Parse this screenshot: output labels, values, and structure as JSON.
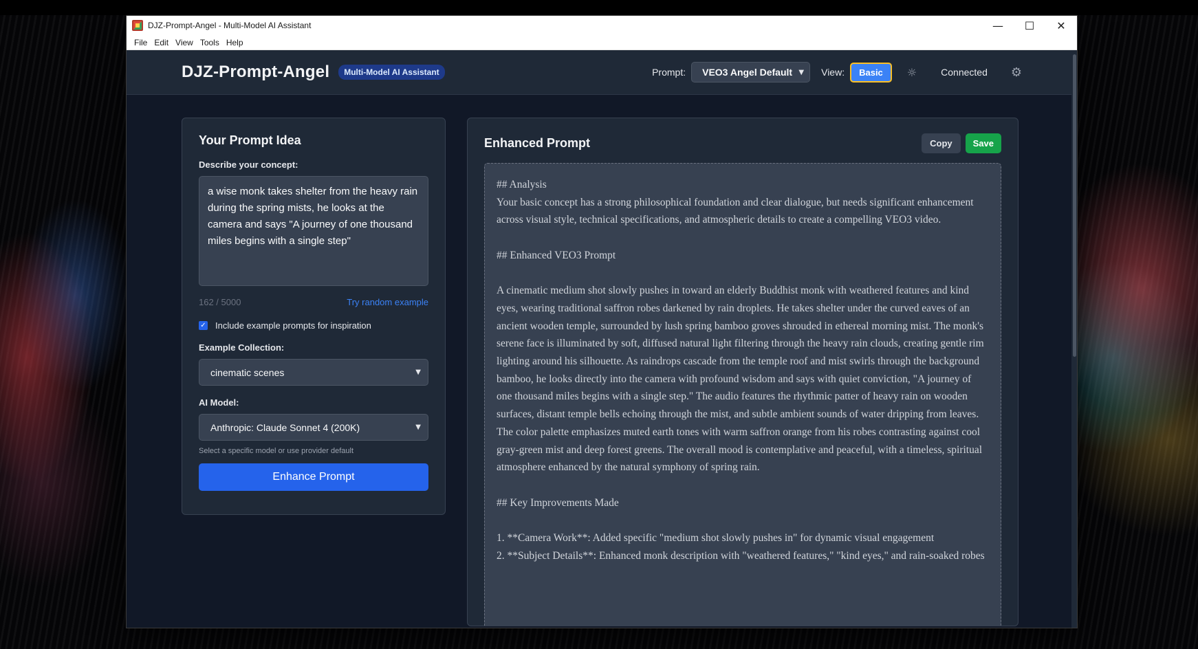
{
  "window": {
    "title": "DJZ-Prompt-Angel - Multi-Model AI Assistant",
    "controls": {
      "minimize": "—",
      "maximize": "☐",
      "close": "✕"
    }
  },
  "menu": [
    "File",
    "Edit",
    "View",
    "Tools",
    "Help"
  ],
  "header": {
    "brand": "DJZ-Prompt-Angel",
    "badge": "Multi-Model AI Assistant",
    "prompt_label": "Prompt:",
    "prompt_value": "VEO3 Angel Default",
    "view_label": "View:",
    "view_value": "Basic",
    "theme_icon": "sun-icon",
    "status": "Connected",
    "settings_icon": "gear-icon"
  },
  "left_panel": {
    "title": "Your Prompt Idea",
    "concept_label": "Describe your concept:",
    "concept_value": "a wise monk takes shelter from the heavy rain during the spring mists, he looks at the camera and says \"A journey of one thousand miles begins with a single step\"",
    "char_count": "162 / 5000",
    "random_link": "Try random example",
    "include_examples_label": "Include example prompts for inspiration",
    "include_examples_checked": true,
    "collection_label": "Example Collection:",
    "collection_value": "cinematic scenes",
    "model_label": "AI Model:",
    "model_value": "Anthropic: Claude Sonnet 4 (200K)",
    "model_helper": "Select a specific model or use provider default",
    "enhance_button": "Enhance Prompt"
  },
  "right_panel": {
    "title": "Enhanced Prompt",
    "copy_button": "Copy",
    "save_button": "Save",
    "output": {
      "h_analysis": "## Analysis",
      "analysis": "Your basic concept has a strong philosophical foundation and clear dialogue, but needs significant enhancement across visual style, technical specifications, and atmospheric details to create a compelling VEO3 video.",
      "h_enhanced": "## Enhanced VEO3 Prompt",
      "enhanced": "A cinematic medium shot slowly pushes in toward an elderly Buddhist monk with weathered features and kind eyes, wearing traditional saffron robes darkened by rain droplets. He takes shelter under the curved eaves of an ancient wooden temple, surrounded by lush spring bamboo groves shrouded in ethereal morning mist. The monk's serene face is illuminated by soft, diffused natural light filtering through the heavy rain clouds, creating gentle rim lighting around his silhouette. As raindrops cascade from the temple roof and mist swirls through the background bamboo, he looks directly into the camera with profound wisdom and says with quiet conviction, \"A journey of one thousand miles begins with a single step.\" The audio features the rhythmic patter of heavy rain on wooden surfaces, distant temple bells echoing through the mist, and subtle ambient sounds of water dripping from leaves. The color palette emphasizes muted earth tones with warm saffron orange from his robes contrasting against cool gray-green mist and deep forest greens. The overall mood is contemplative and peaceful, with a timeless, spiritual atmosphere enhanced by the natural symphony of spring rain.",
      "h_improvements": "## Key Improvements Made",
      "improvement_1": "1. **Camera Work**: Added specific \"medium shot slowly pushes in\" for dynamic visual engagement",
      "improvement_2": "2. **Subject Details**: Enhanced monk description with \"weathered features,\" \"kind eyes,\" and rain-soaked robes"
    }
  },
  "colors": {
    "app_bg": "#111827",
    "panel_bg": "#1f2937",
    "accent_blue": "#2563eb",
    "save_green": "#16a34a",
    "focus_ring": "#fbbf24"
  }
}
